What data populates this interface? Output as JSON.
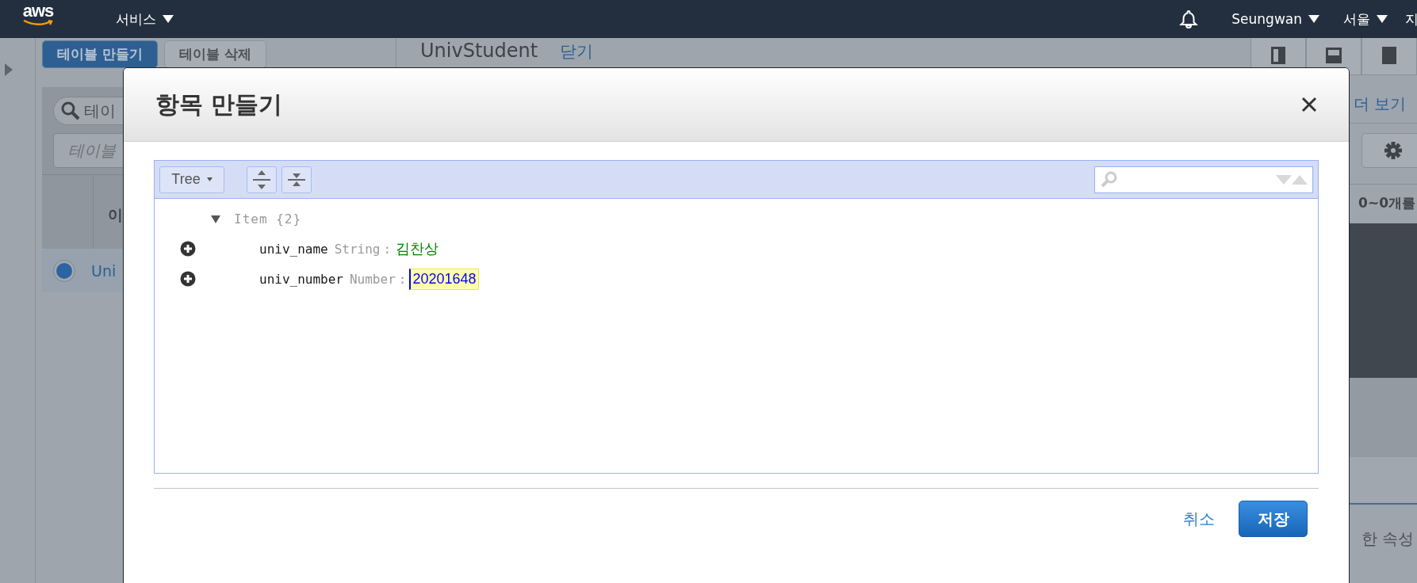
{
  "top_nav": {
    "logo": "aws",
    "services": "서비스",
    "user": "Seungwan",
    "region": "서울",
    "extra": "지"
  },
  "background": {
    "create_button": "테이블 만들기",
    "delete_button": "테이블 삭제",
    "search_placeholder": "테이",
    "filter_placeholder": "테이블",
    "column_header": "이",
    "rows": [
      {
        "name": "Uni",
        "selected": true
      }
    ],
    "table_title": "UnivStudent",
    "close_link": "닫기",
    "more_link": "더 보기",
    "count_text": "0~0개를",
    "bottom_text": "한 속성"
  },
  "dialog": {
    "title": "항목 만들기",
    "mode": "Tree",
    "separator": ":",
    "tree": [
      {
        "key": "Item",
        "summary": "{2}",
        "expanded": true,
        "children": [
          {
            "key": "univ_name",
            "type_label": "String",
            "kind": "string",
            "value": "김찬상",
            "editing": false
          },
          {
            "key": "univ_number",
            "type_label": "Number",
            "kind": "number",
            "value": "20201648",
            "editing": true
          }
        ]
      }
    ],
    "cancel": "취소",
    "save": "저장"
  }
}
